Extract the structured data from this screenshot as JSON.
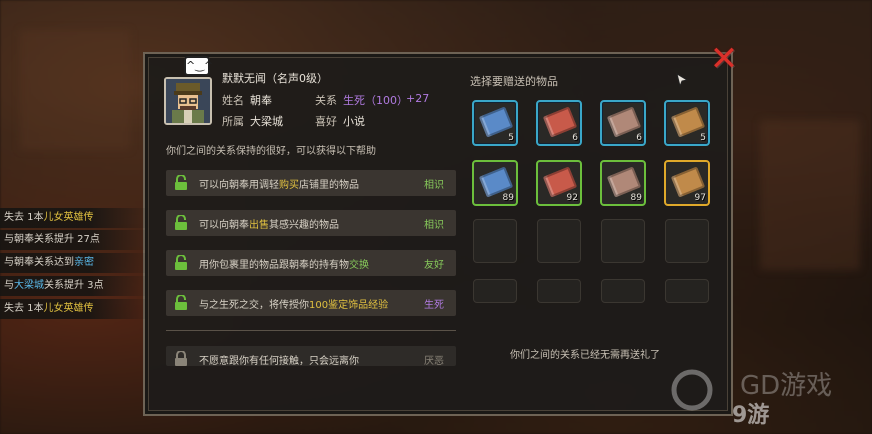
{
  "npc": {
    "title": "默默无闻（名声0级）",
    "name_label": "姓名",
    "name": "朝奉",
    "relation_label": "关系",
    "relation": "生死（100）",
    "relation_delta": "+27",
    "affiliation_label": "所属",
    "affiliation": "大梁城",
    "hobby_label": "喜好",
    "hobby": "小说"
  },
  "relation_desc": "你们之间的关系保持的很好，可以获得以下帮助",
  "perks": [
    {
      "pre": "可以向朝奉用调轻",
      "hl": "购买",
      "post": "店铺里的物品",
      "tier": "相识",
      "hl_color": "#e0c040",
      "tier_color": "#86c85a"
    },
    {
      "pre": "可以向朝奉",
      "hl": "出售",
      "post": "其感兴趣的物品",
      "tier": "相识",
      "hl_color": "#e0c040",
      "tier_color": "#86c85a"
    },
    {
      "pre": "用你包裹里的物品跟朝奉的持有物",
      "hl": "交换",
      "post": "",
      "tier": "友好",
      "hl_color": "#86c85a",
      "tier_color": "#86c85a"
    },
    {
      "pre": "与之生死之交，将传授你",
      "hl": "100鉴定饰品经验",
      "post": "",
      "tier": "生死",
      "hl_color": "#e0c040",
      "tier_color": "#b07ae0"
    },
    {
      "pre": "不愿意跟你有任何接触，只会远离你",
      "hl": "",
      "post": "",
      "tier": "厌恶",
      "hl_color": "#e0c040",
      "tier_color": "#8a8478"
    }
  ],
  "gift": {
    "header": "选择要赠送的物品",
    "footer": "你们之间的关系已经无需再送礼了",
    "items": [
      {
        "count": "5",
        "frame": "blue",
        "color": "#5a8ac8"
      },
      {
        "count": "6",
        "frame": "blue",
        "color": "#c85a4a"
      },
      {
        "count": "6",
        "frame": "blue",
        "color": "#b08878"
      },
      {
        "count": "5",
        "frame": "blue",
        "color": "#c08a4a"
      },
      {
        "count": "89",
        "frame": "green",
        "color": "#5a8ac8"
      },
      {
        "count": "92",
        "frame": "green",
        "color": "#c85a4a"
      },
      {
        "count": "89",
        "frame": "green",
        "color": "#b08878"
      },
      {
        "count": "97",
        "frame": "gold",
        "color": "#c08a4a"
      }
    ]
  },
  "log": [
    {
      "pre": "失去 1本",
      "hl": "儿女英雄传",
      "post": "",
      "hl_color": "#e0c040"
    },
    {
      "pre": "与朝奉关系提升 27点",
      "hl": "",
      "post": "",
      "hl_color": "#e0c040"
    },
    {
      "pre": "与朝奉关系达到",
      "hl": "亲密",
      "post": "",
      "hl_color": "#5ab8e8"
    },
    {
      "pre": "与",
      "hl": "大梁城",
      "post": "关系提升 3点",
      "hl_color": "#5ab8e8"
    },
    {
      "pre": "失去 1本",
      "hl": "儿女英雄传",
      "post": "",
      "hl_color": "#e0c040"
    }
  ],
  "watermark": {
    "text": "9游",
    "brand": "GD游戏"
  },
  "colors": {
    "accent_blue": "#3aa7c8",
    "accent_green": "#6cbf3c",
    "accent_gold": "#e0a92a",
    "close": "#d9302a"
  }
}
